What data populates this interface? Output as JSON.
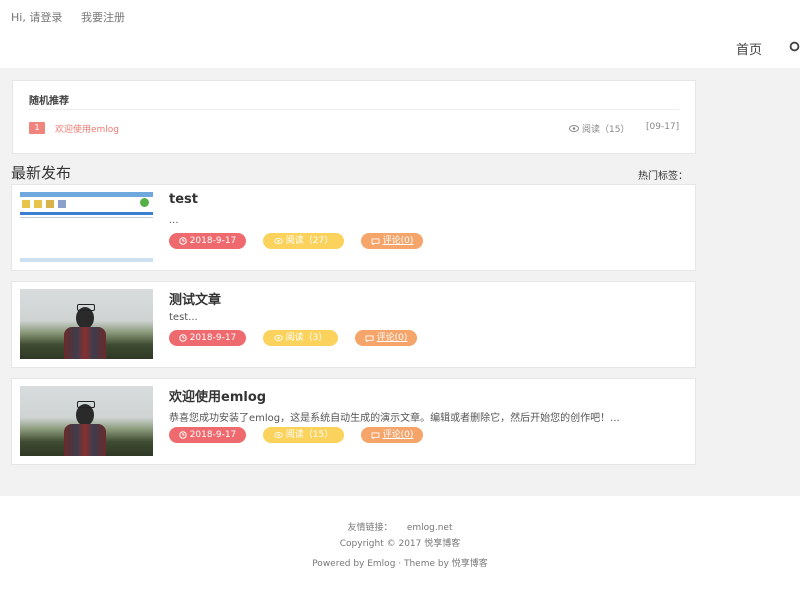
{
  "header": {
    "login_text": "Hi, 请登录",
    "register_text": "我要注册",
    "nav_home": "首页",
    "search_icon": "search-icon"
  },
  "random": {
    "title": "随机推荐",
    "item": {
      "rank": "1",
      "title": "欢迎使用emlog",
      "views": "阅读（15）",
      "date": "[09-17]"
    }
  },
  "latest": {
    "title": "最新发布",
    "hot_tags_label": "热门标签："
  },
  "posts": [
    {
      "title": "test",
      "excerpt": "...",
      "date": "2018-9-17",
      "views": "阅读（27）",
      "comments": "评论(0)",
      "thumb": "screenshot"
    },
    {
      "title": "测试文章",
      "excerpt": "test...",
      "date": "2018-9-17",
      "views": "阅读（3）",
      "comments": "评论(0)",
      "thumb": "photo"
    },
    {
      "title": "欢迎使用emlog",
      "excerpt": "恭喜您成功安装了emlog，这是系统自动生成的演示文章。编辑或者删除它，然后开始您的创作吧！...",
      "date": "2018-9-17",
      "views": "阅读（15）",
      "comments": "评论(0)",
      "thumb": "photo"
    }
  ],
  "footer": {
    "links_label": "友情链接：",
    "link_text": "emlog.net",
    "copyright": "Copyright © 2017 悦享博客",
    "powered": "Powered by Emlog · Theme by 悦享博客"
  },
  "colors": {
    "accent": "#f07a70",
    "date_pill": "#ef6a6e",
    "views_pill": "#fbd25c",
    "comments_pill": "#f5a46a"
  }
}
